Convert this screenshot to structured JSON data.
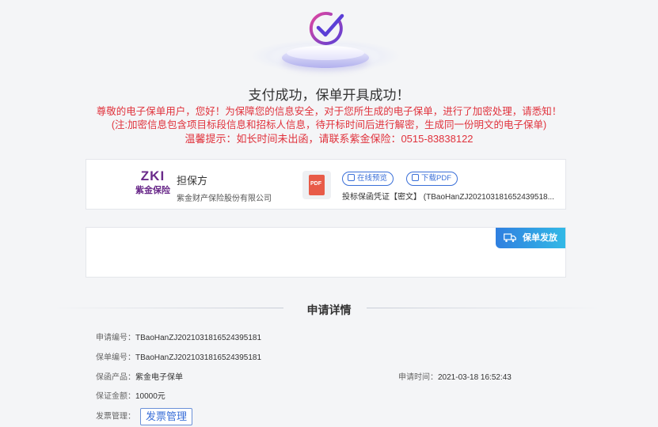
{
  "result": {
    "title": "支付成功，保单开具成功！",
    "notice_line1": "尊敬的电子保单用户，您好！为保障您的信息安全，对于您所生成的电子保单，进行了加密处理，请悉知！",
    "notice_line2": "(注:加密信息包含项目标段信息和招标人信息，待开标时间后进行解密，生成同一份明文的电子保单)",
    "notice_line3": "温馨提示：如长时间未出函，请联系紫金保险：0515-83838122"
  },
  "guarantor": {
    "logo_text": "ZKI",
    "logo_cn": "紫金保险",
    "label": "担保方",
    "company": "紫金财产保险股份有限公司",
    "file_icon": "pdf-file-icon",
    "preview_label": "在线预览",
    "download_label": "下载PDF",
    "document_name": "投标保函凭证【密文】 (TBaoHanZJ202103181652439518..."
  },
  "issuance": {
    "tag_label": "保单发放",
    "tag_icon": "truck-icon"
  },
  "details": {
    "section_title": "申请详情",
    "application_no_label": "申请编号：",
    "application_no": "TBaoHanZJ2021031816524395181",
    "policy_no_label": "保单编号：",
    "policy_no": "TBaoHanZJ2021031816524395181",
    "product_label": "保函产品：",
    "product": "紫金电子保单",
    "apply_time_label": "申请时间：",
    "apply_time": "2021-03-18 16:52:43",
    "amount_label": "保证金额：",
    "amount": "10000元",
    "invoice_label": "发票管理：",
    "invoice_button": "发票管理"
  },
  "colors": {
    "accent": "#3a6fd8",
    "warning": "#e0323c",
    "tag_gradient_start": "#2f7fe0",
    "tag_gradient_end": "#32b9e6"
  }
}
